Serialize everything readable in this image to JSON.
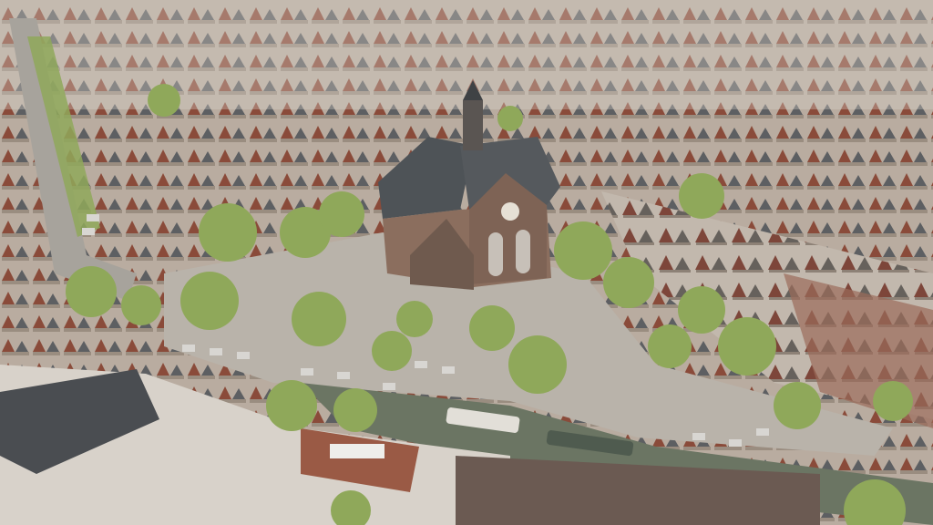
{
  "image": {
    "subject": "aerial-city-view",
    "colors": {
      "roofs": "#8a4b3a",
      "slate": "#4e5357",
      "facade": "#a99b8c",
      "trees": "#8fa85a",
      "water": "#6b7563",
      "square": "#b9b3aa",
      "street": "#a7a39c"
    }
  }
}
